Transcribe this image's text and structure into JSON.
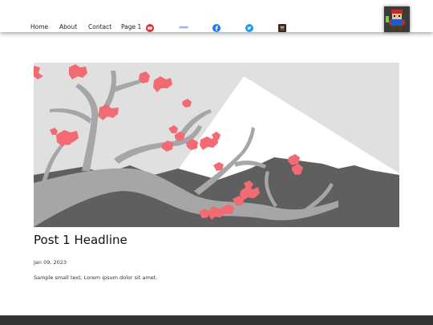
{
  "nav": {
    "links": [
      "Home",
      "About",
      "Contact",
      "Page 1"
    ],
    "icons": [
      "youtube-icon",
      "blogger-icon",
      "facebook-icon",
      "twitter-icon",
      "app-icon"
    ]
  },
  "post": {
    "headline": "Post 1 Headline",
    "date": "Jan 09, 2023",
    "text": "Sample small text. Lorem ipsum dolor sit amet."
  },
  "colors": {
    "accent_blossom": "#f26b72",
    "mountain_dark": "#5f5f5f",
    "snow": "#ffffff",
    "branch": "#a6a6a6",
    "footer": "#333333"
  }
}
